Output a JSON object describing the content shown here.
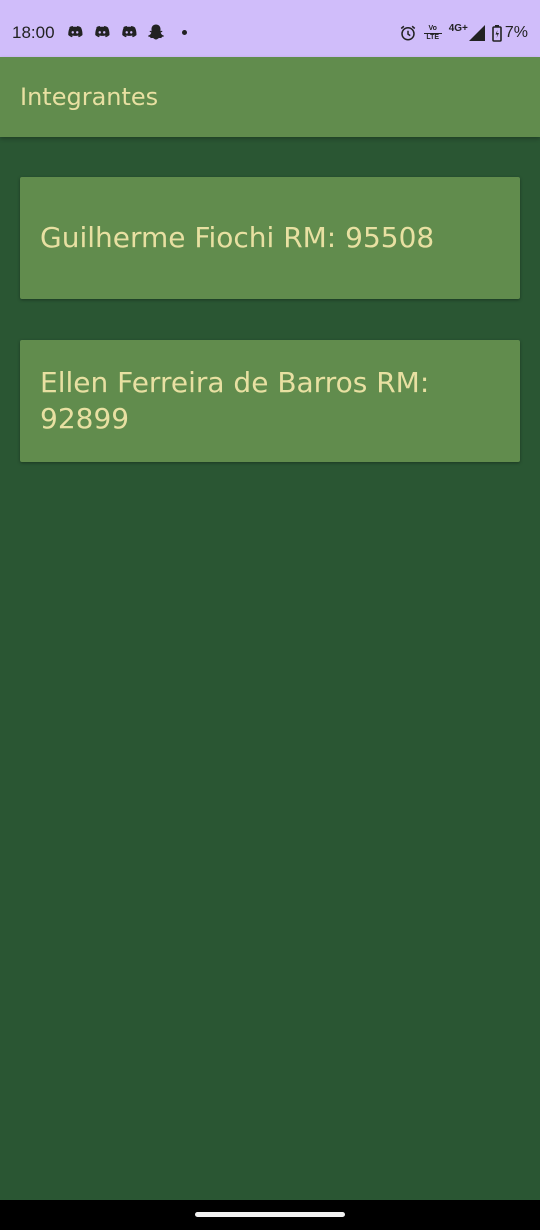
{
  "status_bar": {
    "time": "18:00",
    "left_icons": [
      "discord-icon",
      "discord-icon",
      "discord-icon",
      "snapchat-icon",
      "dot-icon"
    ],
    "right_icons": [
      "alarm-icon",
      "volte-icon",
      "network-4g-icon",
      "signal-icon",
      "battery-icon"
    ],
    "volte_label_top": "Vo",
    "volte_label_bottom": "LTE",
    "network_label": "4G+",
    "battery_percent": "7%"
  },
  "app_bar": {
    "title": "Integrantes"
  },
  "members": [
    {
      "text": "Guilherme Fiochi RM: 95508"
    },
    {
      "text": "Ellen Ferreira de Barros RM: 92899"
    }
  ],
  "colors": {
    "status_bar_bg": "#d0bdfa",
    "app_bar_bg": "#618c4d",
    "background": "#2a5633",
    "card_bg": "#618c4d",
    "text": "#e8e0a2"
  }
}
